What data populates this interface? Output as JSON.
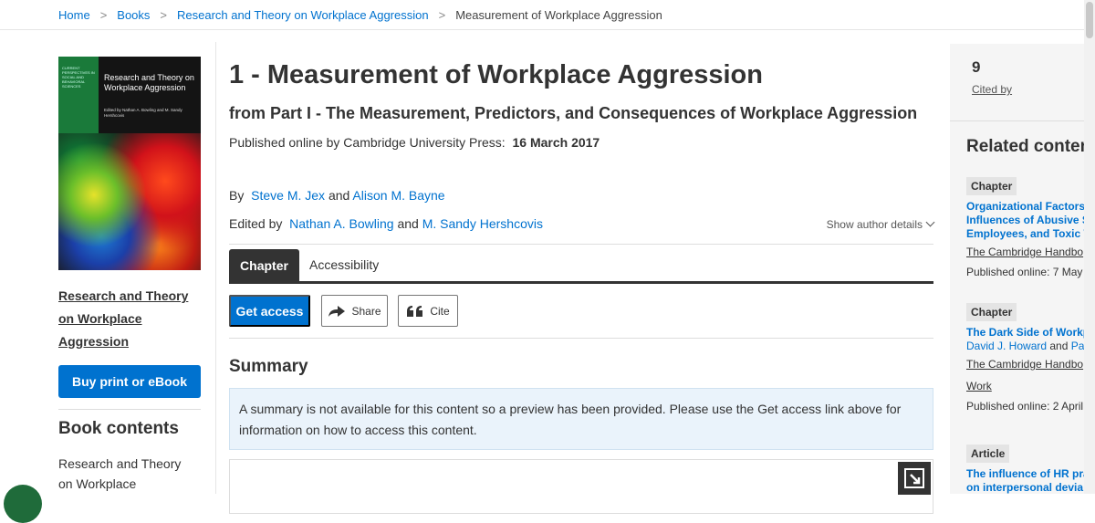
{
  "breadcrumb": {
    "items": [
      "Home",
      "Books",
      "Research and Theory on Workplace Aggression"
    ],
    "current": "Measurement of Workplace Aggression",
    "separator": ">"
  },
  "book": {
    "cover": {
      "series": "CURRENT PERSPECTIVES IN SOCIAL AND BEHAVIORAL SCIENCES",
      "title": "Research and Theory on Workplace Aggression",
      "editors": "Edited by Nathan A. Bowling and M. Sandy Hershcovis"
    },
    "link_lines": [
      "Research and Theory",
      "on Workplace",
      "Aggression"
    ],
    "buy_label": "Buy print or eBook",
    "contents_heading": "Book contents",
    "contents_first_item": "Research and Theory on Workplace Aggression"
  },
  "chapter": {
    "title": "1 - Measurement of Workplace Aggression",
    "subtitle": "from Part I - The Measurement, Predictors, and Consequences of Workplace Aggression",
    "published_label": "Published online by Cambridge University Press:",
    "published_date": "16 March 2017",
    "by_label": "By",
    "authors": [
      "Steve M. Jex",
      "Alison M. Bayne"
    ],
    "and": "and",
    "edited_label": "Edited by",
    "editors": [
      "Nathan A. Bowling",
      "M. Sandy Hershcovis"
    ],
    "show_details": "Show author details"
  },
  "tabs": [
    "Chapter",
    "Accessibility"
  ],
  "actions": {
    "get_access": "Get access",
    "share": "Share",
    "cite": "Cite"
  },
  "summary": {
    "heading": "Summary",
    "text": "A summary is not available for this content so a preview has been provided. Please use the Get access link above for information on how to access this content."
  },
  "sidebar": {
    "cited_count": "9",
    "cited_label": "Cited by",
    "related_heading": "Related content",
    "related": [
      {
        "type": "Chapter",
        "title_lines": [
          "Organizational Factors",
          "Influences of Abusive S",
          "Employees, and Toxic W"
        ],
        "book": "The Cambridge Handbo",
        "published": "Published online: 7 May"
      },
      {
        "type": "Chapter",
        "title_lines": [
          "The Dark Side of Workp"
        ],
        "author": "David J. Howard",
        "author_and": "and",
        "author2": "Pa",
        "book_lines": [
          "The Cambridge Handbo",
          "Work"
        ],
        "published": "Published online: 2 April"
      },
      {
        "type": "Article",
        "title_lines": [
          "The influence of HR pra",
          "on interpersonal devia"
        ]
      }
    ]
  },
  "colors": {
    "link": "#0072cf",
    "primary_button": "#0072cf",
    "active_tab": "#333333",
    "summary_bg": "#eaf3fb"
  }
}
